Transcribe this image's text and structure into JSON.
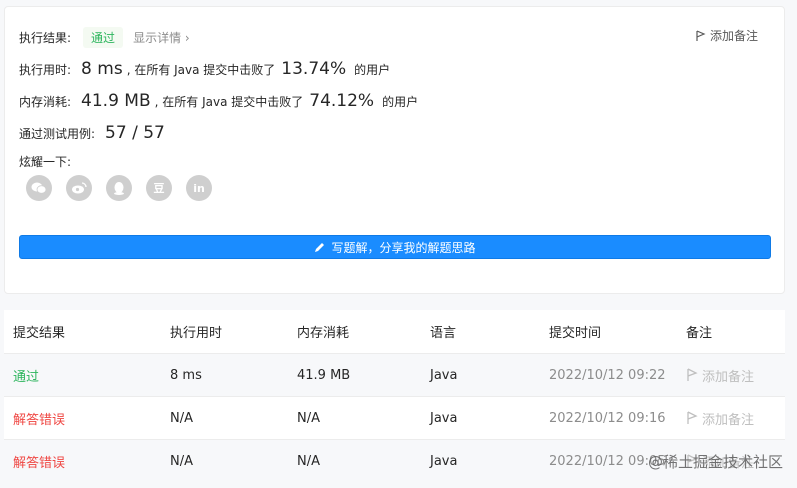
{
  "result": {
    "label": "执行结果:",
    "status": "通过",
    "details_link": "显示详情 ›",
    "add_note": "添加备注"
  },
  "runtime": {
    "label": "执行用时:",
    "value": "8 ms",
    "mid": ", 在所有 Java 提交中击败了",
    "percent": "13.74%",
    "suffix": "的用户"
  },
  "memory": {
    "label": "内存消耗:",
    "value": "41.9 MB",
    "mid": ", 在所有 Java 提交中击败了",
    "percent": "74.12%",
    "suffix": "的用户"
  },
  "tests": {
    "label": "通过测试用例:",
    "value": "57 / 57"
  },
  "share": {
    "label": "炫耀一下:",
    "icons": [
      "wechat-icon",
      "weibo-icon",
      "qq-icon",
      "douban-icon",
      "linkedin-icon"
    ],
    "douban_glyph": "豆",
    "linkedin_glyph": "in"
  },
  "solution_button": "写题解，分享我的解题思路",
  "table": {
    "headers": [
      "提交结果",
      "执行用时",
      "内存消耗",
      "语言",
      "提交时间",
      "备注"
    ],
    "rows": [
      {
        "status": "通过",
        "status_type": "pass",
        "runtime": "8 ms",
        "memory": "41.9 MB",
        "lang": "Java",
        "time": "2022/10/12 09:22",
        "note": "添加备注"
      },
      {
        "status": "解答错误",
        "status_type": "fail",
        "runtime": "N/A",
        "memory": "N/A",
        "lang": "Java",
        "time": "2022/10/12 09:16",
        "note": "添加备注"
      },
      {
        "status": "解答错误",
        "status_type": "fail",
        "runtime": "N/A",
        "memory": "N/A",
        "lang": "Java",
        "time": "2022/10/12 09:05",
        "note": "添加备注"
      }
    ]
  },
  "watermark": "@稀土掘金技术社区",
  "colors": {
    "pass": "#2db55d",
    "fail": "#ef4743",
    "primary": "#1a8cff"
  }
}
